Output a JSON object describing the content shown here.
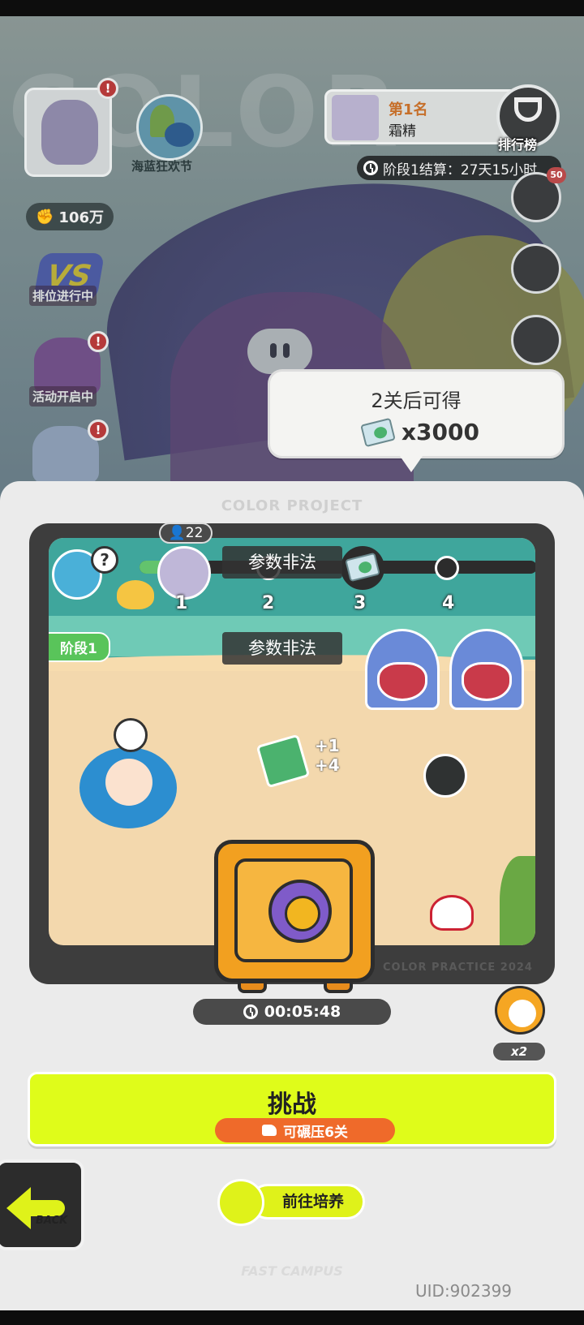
{
  "top_left": {
    "power_value": "106万",
    "event_label": "海蓝狂欢节",
    "ranked_label": "排位进行中",
    "activity_label": "活动开启中",
    "badge_mark": "!",
    "vs_text": "VS"
  },
  "ranking": {
    "place": "第1名",
    "player_name": "霜精",
    "button_label": "排行榜",
    "stage_settlement": "阶段1结算：27天15小时"
  },
  "right_side": {
    "badge_count": "50"
  },
  "tooltip": {
    "title": "2关后可得",
    "reward_amount": "x3000",
    "reward_icon": "ticket-icon"
  },
  "panel": {
    "title": "COLOR PROJECT",
    "watermark": "COLOR PRACTICE 2024",
    "player_count": "22",
    "help_mark": "?",
    "stage_tag": "阶段1",
    "nodes": [
      "1",
      "2",
      "3",
      "4"
    ],
    "toast_1": "参数非法",
    "toast_2": "参数非法",
    "loot_plus_1": "+1",
    "loot_plus_2": "+4",
    "countdown": "00:05:48",
    "speed_label": "x2",
    "progress": 0.17
  },
  "actions": {
    "challenge_label": "挑战",
    "challenge_sub": "可碾压6关",
    "back_label": "BACK",
    "cultivate_label": "前往培养"
  },
  "footer": {
    "brand": "FAST CAMPUS",
    "uid": "UID:902399"
  },
  "colors": {
    "accent_lime": "#dffc1a",
    "accent_orange": "#ef6a2a",
    "rank_orange": "#c66f2a",
    "progress_green": "#63c36d"
  }
}
